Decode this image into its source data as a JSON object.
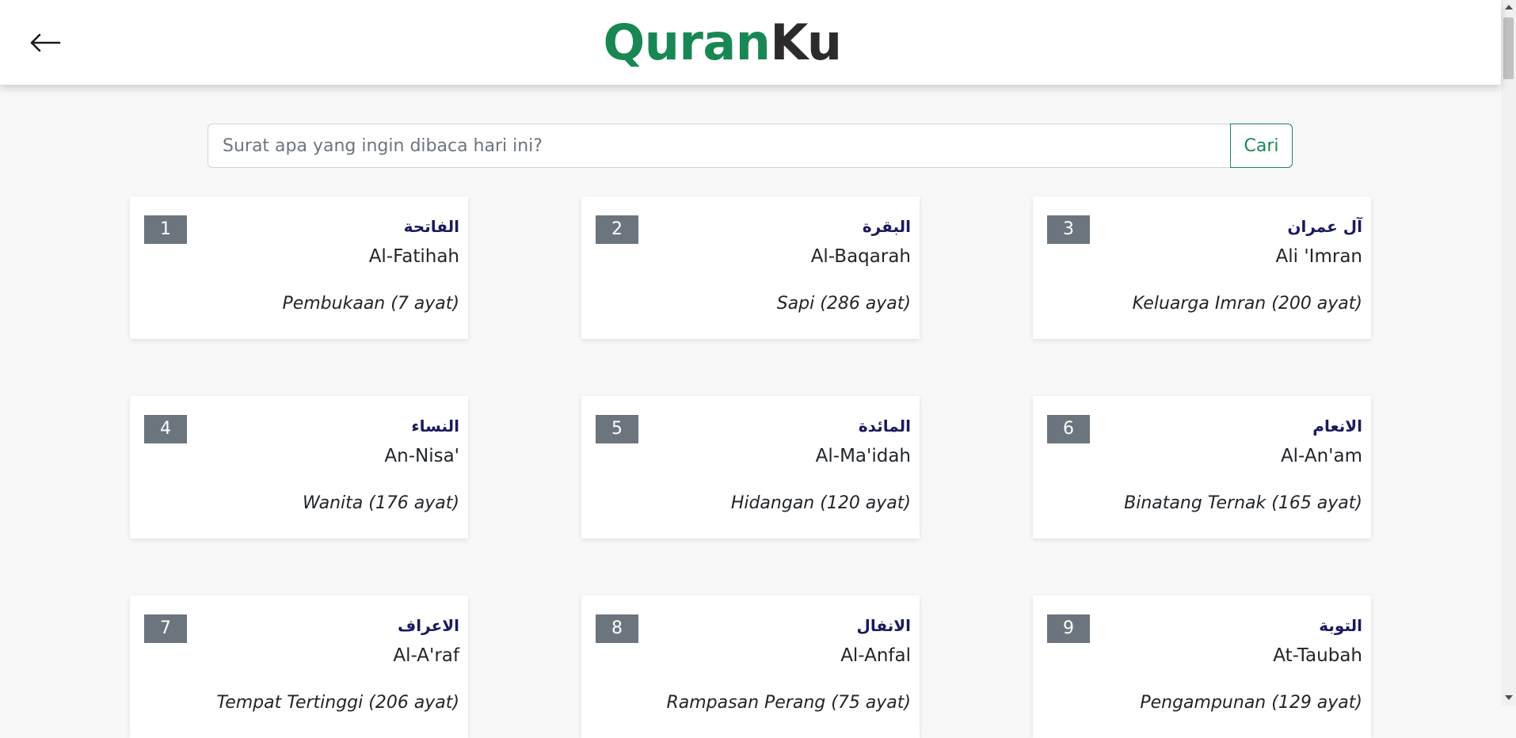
{
  "navbar": {
    "back_icon": "arrow-left-icon",
    "brand_part1": "Quran",
    "brand_part2": "Ku",
    "brand_colors": {
      "primary": "#198754",
      "secondary": "#2b2b2b"
    }
  },
  "search": {
    "placeholder": "Surat apa yang ingin dibaca hari ini?",
    "value": "",
    "button_label": "Cari"
  },
  "colors": {
    "accent": "#198754",
    "badge": "#6c757d",
    "arabic_text": "#1a1a5e",
    "background": "#f8f8f8"
  },
  "surahs": [
    {
      "number": "1",
      "arabic": "الفاتحة",
      "latin": "Al-Fatihah",
      "meaning": "Pembukaan (7 ayat)"
    },
    {
      "number": "2",
      "arabic": "البقرة",
      "latin": "Al-Baqarah",
      "meaning": "Sapi (286 ayat)"
    },
    {
      "number": "3",
      "arabic": "آل عمران",
      "latin": "Ali 'Imran",
      "meaning": "Keluarga Imran (200 ayat)"
    },
    {
      "number": "4",
      "arabic": "النساء",
      "latin": "An-Nisa'",
      "meaning": "Wanita (176 ayat)"
    },
    {
      "number": "5",
      "arabic": "المائدة",
      "latin": "Al-Ma'idah",
      "meaning": "Hidangan (120 ayat)"
    },
    {
      "number": "6",
      "arabic": "الانعام",
      "latin": "Al-An'am",
      "meaning": "Binatang Ternak (165 ayat)"
    },
    {
      "number": "7",
      "arabic": "الاعراف",
      "latin": "Al-A'raf",
      "meaning": "Tempat Tertinggi (206 ayat)"
    },
    {
      "number": "8",
      "arabic": "الانفال",
      "latin": "Al-Anfal",
      "meaning": "Rampasan Perang (75 ayat)"
    },
    {
      "number": "9",
      "arabic": "التوبة",
      "latin": "At-Taubah",
      "meaning": "Pengampunan (129 ayat)"
    }
  ]
}
